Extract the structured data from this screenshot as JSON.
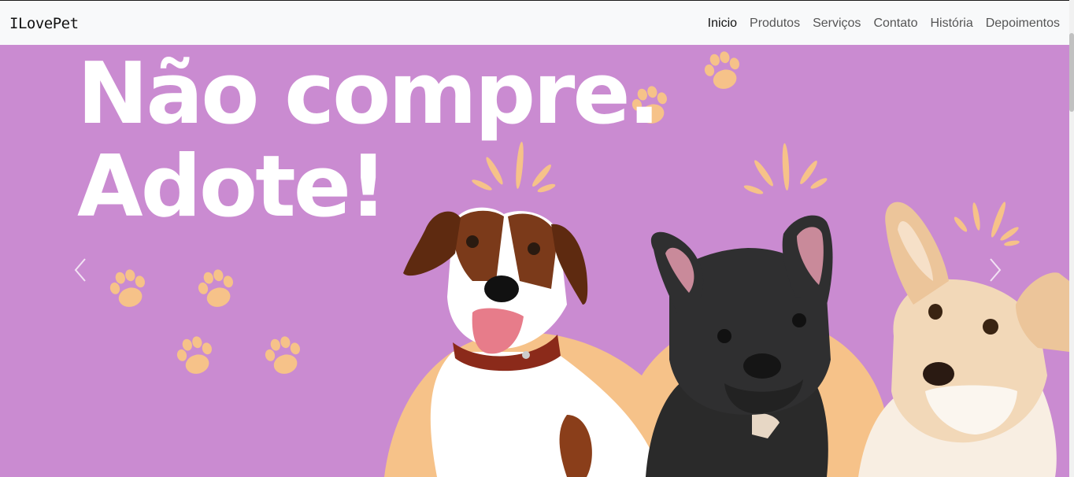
{
  "navbar": {
    "brand": "ILovePet",
    "links": [
      "Inicio",
      "Produtos",
      "Serviços",
      "Contato",
      "História",
      "Depoimentos"
    ],
    "active": "Inicio"
  },
  "hero": {
    "headline_line1": "Não compre.",
    "headline_line2": "Adote!",
    "background_color": "#ca8bd1",
    "accent_color": "#f6c289",
    "prev_icon": "chevron-left-icon",
    "next_icon": "chevron-right-icon"
  }
}
